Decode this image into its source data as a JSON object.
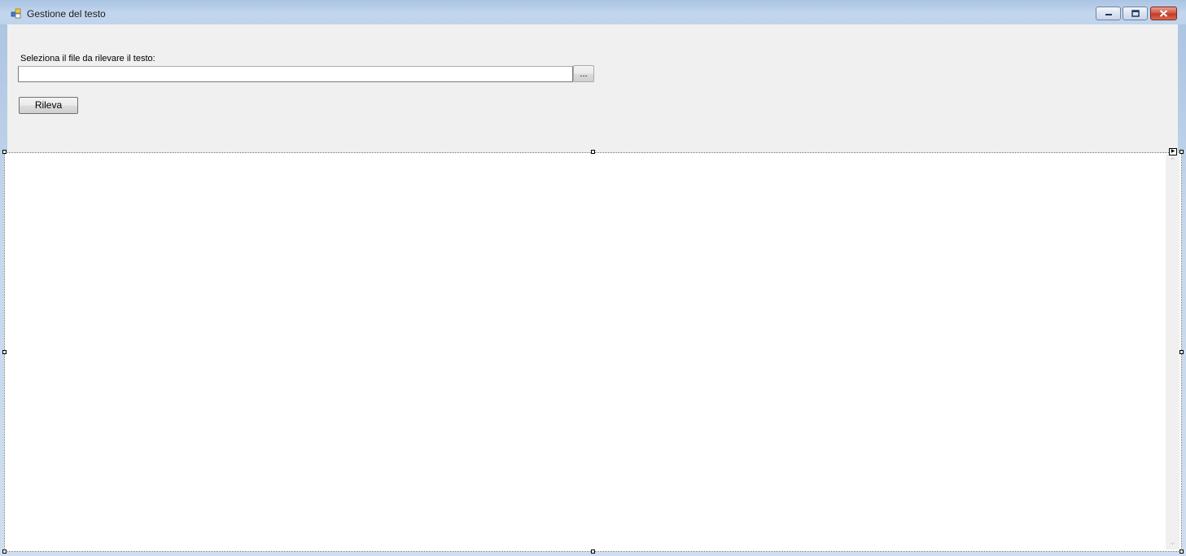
{
  "window": {
    "title": "Gestione del testo",
    "icon": "winforms-app-icon",
    "controls": {
      "minimize": "minimize-icon",
      "maximize": "maximize-icon",
      "close": "close-icon"
    }
  },
  "form": {
    "file_label": "Seleziona il file da rilevare il testo:",
    "file_input_value": "",
    "browse_label": "...",
    "detect_label": "Rileva"
  },
  "output": {
    "text": ""
  },
  "colors": {
    "titlebar": "#c2d6ee",
    "client_bg": "#f0f0f0",
    "close_red": "#c43b26"
  }
}
